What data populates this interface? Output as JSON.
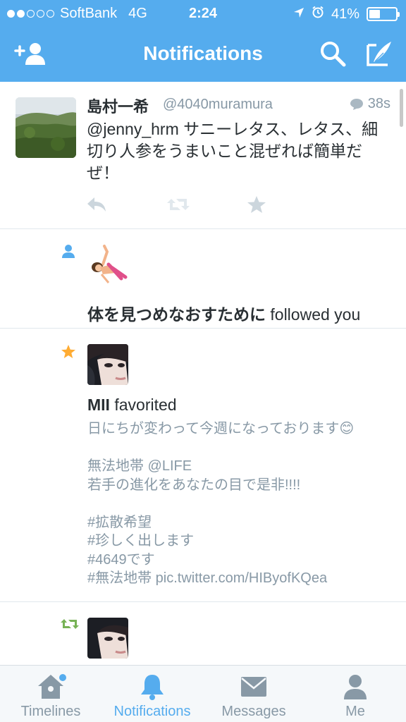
{
  "status_bar": {
    "carrier": "SoftBank",
    "network": "4G",
    "time": "2:24",
    "battery": "41%",
    "battery_level": 0.41
  },
  "nav": {
    "title": "Notifications"
  },
  "tweet": {
    "name": "島村一希",
    "handle": "@4040muramura",
    "time": "38s",
    "text": "@jenny_hrm サニーレタス、レタス、細切り人参をうまいこと混ぜれば簡単だぜ！"
  },
  "follow": {
    "name": "体を見つめなおすために",
    "action": "followed you"
  },
  "favorite": {
    "name": "MII",
    "action": "favorited",
    "text": "日にちが変わって今週になっております😊\n\n無法地帯 @LIFE\n若手の進化をあなたの目で是非!!!!\n\n#拡散希望\n#珍しく出します\n#4649です\n#無法地帯 pic.twitter.com/HIByofKQea"
  },
  "tabs": [
    {
      "label": "Timelines",
      "icon": "home-icon",
      "active": false
    },
    {
      "label": "Notifications",
      "icon": "bell-icon",
      "active": true
    },
    {
      "label": "Messages",
      "icon": "envelope-icon",
      "active": false
    },
    {
      "label": "Me",
      "icon": "person-icon",
      "active": false
    }
  ],
  "colors": {
    "brand": "#55acee",
    "favorite": "#ffac33",
    "retweet": "#77b255",
    "muted": "#8899a6"
  }
}
